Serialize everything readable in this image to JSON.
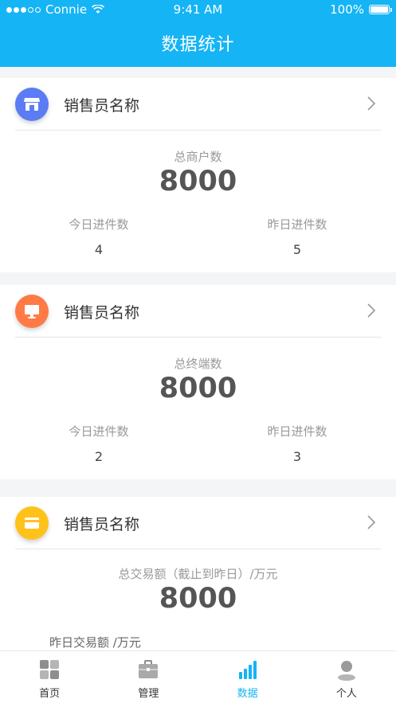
{
  "status_bar": {
    "carrier": "Connie",
    "time": "9:41 AM",
    "battery": "100%"
  },
  "nav": {
    "title": "数据统计"
  },
  "cards": [
    {
      "title": "销售员名称",
      "icon": "store-icon",
      "icon_color": "#5b7cf5",
      "total_label": "总商户数",
      "total_value": "8000",
      "today_label": "今日进件数",
      "today_value": "4",
      "yesterday_label": "昨日进件数",
      "yesterday_value": "5"
    },
    {
      "title": "销售员名称",
      "icon": "monitor-icon",
      "icon_color": "#ff7a45",
      "total_label": "总终端数",
      "total_value": "8000",
      "today_label": "今日进件数",
      "today_value": "2",
      "yesterday_label": "昨日进件数",
      "yesterday_value": "3"
    },
    {
      "title": "销售员名称",
      "icon": "card-icon",
      "icon_color": "#ffc21a",
      "total_label": "总交易额（截止到昨日）/万元",
      "total_value": "8000",
      "yesterday_label": "昨日交易额 /万元"
    }
  ],
  "tabbar": {
    "items": [
      {
        "label": "首页",
        "icon": "home-grid-icon",
        "active": false
      },
      {
        "label": "管理",
        "icon": "briefcase-icon",
        "active": false
      },
      {
        "label": "数据",
        "icon": "bar-chart-icon",
        "active": true
      },
      {
        "label": "个人",
        "icon": "person-icon",
        "active": false
      }
    ]
  },
  "colors": {
    "accent": "#14b4f5",
    "background": "#f4f5f7"
  }
}
